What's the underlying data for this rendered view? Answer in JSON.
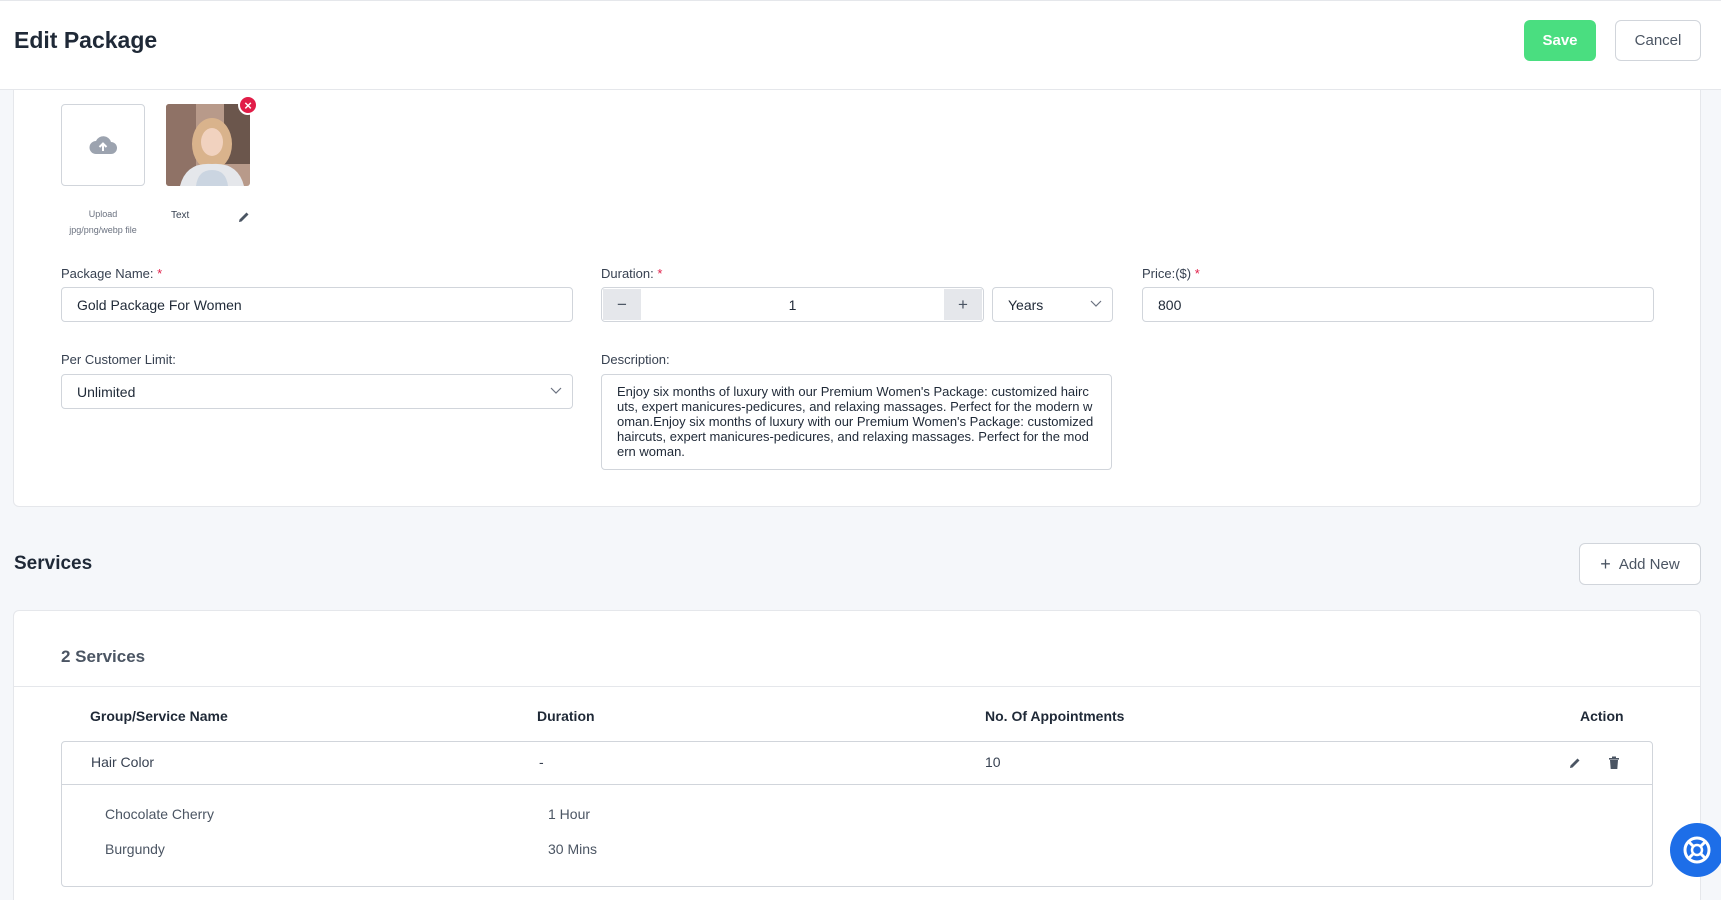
{
  "header": {
    "title": "Edit Package",
    "save_label": "Save",
    "cancel_label": "Cancel"
  },
  "media": {
    "upload_line1": "Upload",
    "upload_line2": "jpg/png/webp file",
    "image_caption": "Text"
  },
  "form": {
    "package_name_label": "Package Name:",
    "package_name_value": "Gold Package For Women",
    "duration_label": "Duration:",
    "duration_minus": "−",
    "duration_value": "1",
    "duration_plus": "+",
    "duration_unit": "Years",
    "price_label": "Price:($)",
    "price_value": "800",
    "limit_label": "Per Customer Limit:",
    "limit_value": "Unlimited",
    "description_label": "Description:",
    "description_value": "Enjoy six months of luxury with our Premium Women's Package: customized haircuts, expert manicures-pedicures, and relaxing massages. Perfect for the modern woman.Enjoy six months of luxury with our Premium Women's Package: customized haircuts, expert manicures-pedicures, and relaxing massages. Perfect for the modern woman.",
    "required_mark": "*"
  },
  "services": {
    "title": "Services",
    "add_label": "Add New",
    "add_icon": "+",
    "count_label": "2 Services",
    "columns": [
      "Group/Service Name",
      "Duration",
      "No. Of Appointments",
      "Action"
    ],
    "groups": [
      {
        "name": "Hair Color",
        "duration": "-",
        "appointments": "10",
        "items": [
          {
            "name": "Chocolate Cherry",
            "duration": "1 Hour"
          },
          {
            "name": "Burgundy",
            "duration": "30 Mins"
          }
        ]
      }
    ]
  },
  "colors": {
    "accent_green": "#4ade80",
    "danger": "#e11d48",
    "help_blue": "#1d6ee8"
  },
  "icons": [
    "cloud-upload-icon",
    "remove-icon",
    "pencil-icon",
    "chevron-down-icon",
    "plus-icon",
    "trash-icon",
    "lifebuoy-icon"
  ]
}
